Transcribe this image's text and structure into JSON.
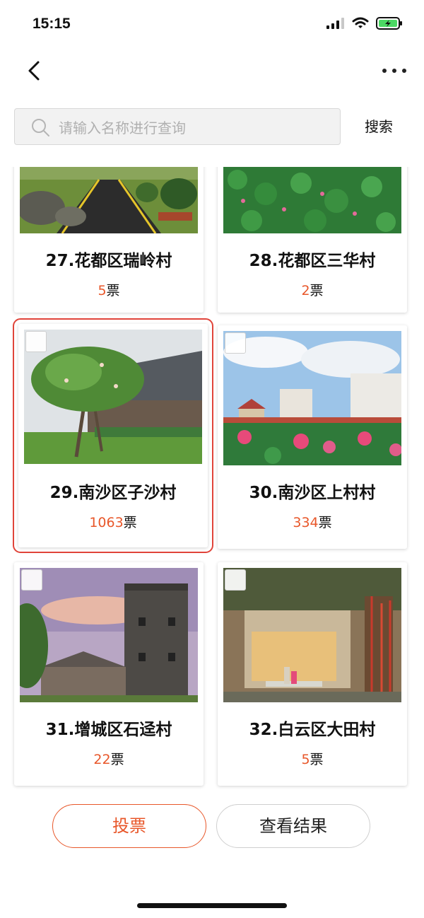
{
  "status": {
    "time": "15:15"
  },
  "search": {
    "placeholder": "请输入名称进行查询",
    "button_label": "搜索"
  },
  "cards": [
    {
      "name": "27.花都区瑞岭村",
      "votes": "5",
      "vote_unit": "票",
      "selected": false
    },
    {
      "name": "28.花都区三华村",
      "votes": "2",
      "vote_unit": "票",
      "selected": false
    },
    {
      "name": "29.南沙区子沙村",
      "votes": "1063",
      "vote_unit": "票",
      "selected": true
    },
    {
      "name": "30.南沙区上村村",
      "votes": "334",
      "vote_unit": "票",
      "selected": false
    },
    {
      "name": "31.增城区石迳村",
      "votes": "22",
      "vote_unit": "票",
      "selected": false
    },
    {
      "name": "32.白云区大田村",
      "votes": "5",
      "vote_unit": "票",
      "selected": false
    }
  ],
  "actions": {
    "vote_label": "投票",
    "results_label": "查看结果"
  },
  "colors": {
    "accent": "#e8572a",
    "selection_border": "#e0443a"
  }
}
